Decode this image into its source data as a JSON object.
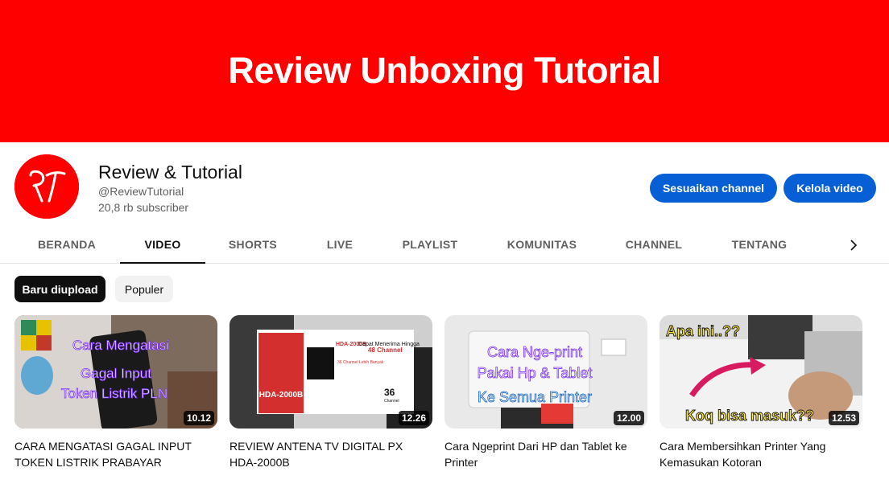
{
  "banner": {
    "title": "Review Unboxing Tutorial"
  },
  "channel": {
    "avatar_text": "RT",
    "name": "Review & Tutorial",
    "handle": "@ReviewTutorial",
    "subscribers": "20,8 rb subscriber",
    "customize_label": "Sesuaikan channel",
    "manage_label": "Kelola video"
  },
  "tabs": [
    {
      "label": "BERANDA",
      "active": false
    },
    {
      "label": "VIDEO",
      "active": true
    },
    {
      "label": "SHORTS",
      "active": false
    },
    {
      "label": "LIVE",
      "active": false
    },
    {
      "label": "PLAYLIST",
      "active": false
    },
    {
      "label": "KOMUNITAS",
      "active": false
    },
    {
      "label": "CHANNEL",
      "active": false
    },
    {
      "label": "TENTANG",
      "active": false
    }
  ],
  "tab_arrow_icon": "chevron-right-icon",
  "filters": {
    "active": "Baru diupload",
    "inactive": "Populer"
  },
  "videos": [
    {
      "title": "CARA MENGATASI GAGAL INPUT TOKEN LISTRIK PRABAYAR",
      "duration": "10.12",
      "overlay": [
        "Cara Mengatasi",
        "Gagal Input",
        "Token Listrik PLN"
      ],
      "meta": ""
    },
    {
      "title": "REVIEW ANTENA TV DIGITAL PX HDA-2000B",
      "duration": "12.26",
      "overlay": [
        "HDA-2000B",
        "Dapat Menerima Hingga",
        "48 Channel",
        "36 Channel Lebih Banyak",
        "HDA-2000B",
        "36",
        "Channel"
      ],
      "meta": ""
    },
    {
      "title": "Cara Ngeprint Dari HP dan Tablet ke Printer",
      "duration": "12.00",
      "overlay": [
        "Cara Nge-print",
        "Pakai Hp & Tablet",
        "Ke Semua Printer"
      ],
      "meta": ""
    },
    {
      "title": "Cara Membersihkan Printer Yang Kemasukan Kotoran",
      "duration": "12.53",
      "overlay": [
        "Apa ini..??",
        "Koq bisa masuk??"
      ],
      "meta": ""
    }
  ]
}
